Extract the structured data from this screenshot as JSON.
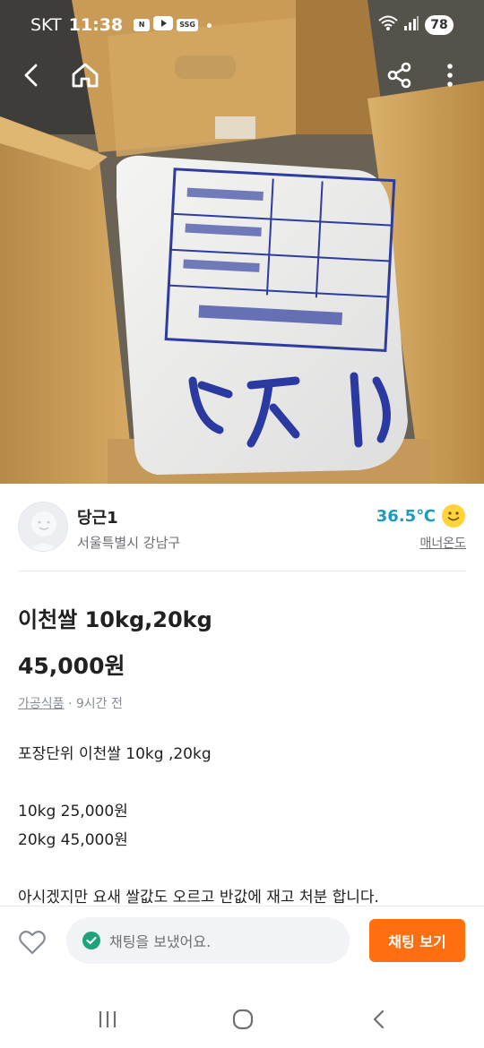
{
  "status_bar": {
    "carrier": "SKT",
    "time": "11:38",
    "apps": [
      "N",
      "SSG"
    ],
    "battery": "78"
  },
  "top_bar": {
    "icons": [
      "back-arrow-icon",
      "home-icon",
      "share-icon",
      "more-vertical-icon"
    ]
  },
  "seller": {
    "name": "당근1",
    "region": "서울특별시 강남구",
    "temperature": "36.5℃",
    "manner_label": "매너온도"
  },
  "listing": {
    "title": "이천쌀 10kg,20kg",
    "price": "45,000원",
    "category": "가공식품",
    "time_ago": "· 9시간 전",
    "description_lines": [
      "포장단위 이천쌀 10kg ,20kg",
      "",
      "10kg 25,000원",
      "20kg 45,000원",
      "",
      "아시겠지만 요새 쌀값도 오르고 반값에 재고 처분 합니다."
    ]
  },
  "action_bar": {
    "chat_status": "채팅을 보냈어요.",
    "chat_button": "채팅 보기"
  },
  "colors": {
    "accent_orange": "#ff6f0f",
    "temperature_blue": "#1d9bbf",
    "check_green": "#1fa37a"
  }
}
